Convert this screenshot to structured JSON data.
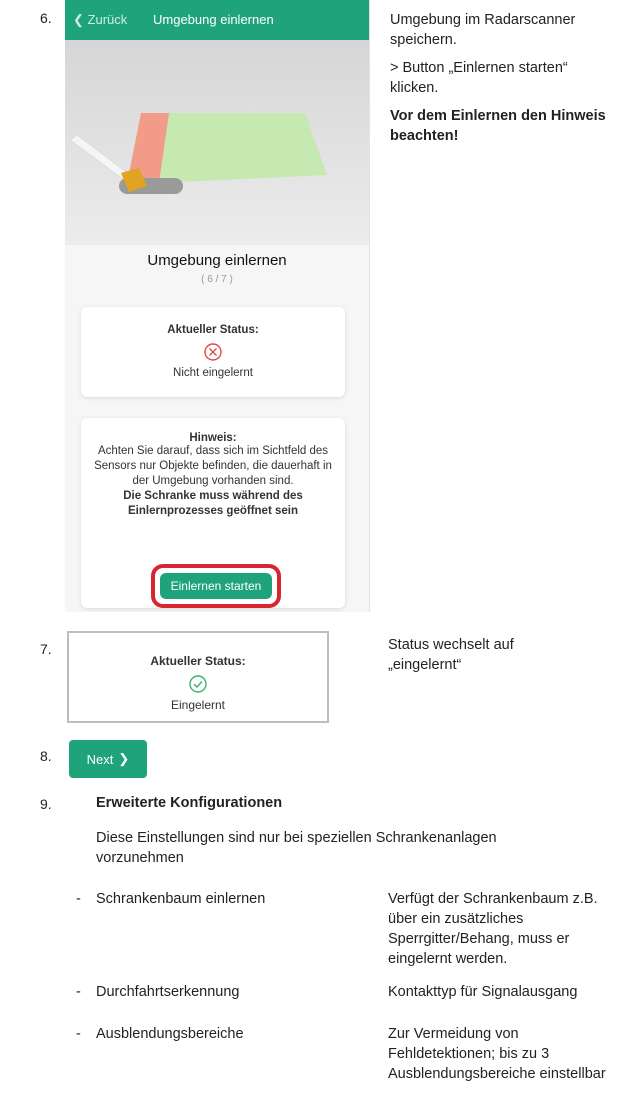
{
  "steps": {
    "s6": {
      "number": "6.",
      "phone": {
        "back_label": "Zurück",
        "title": "Umgebung einlernen",
        "panel_title": "Umgebung einlernen",
        "step_indicator": "( 6 / 7 )",
        "status_card": {
          "heading": "Aktueller Status:",
          "icon": "x-circle-icon",
          "text": "Nicht eingelernt",
          "color": "#e24a4a"
        },
        "hint_card": {
          "heading": "Hinweis:",
          "body": "Achten Sie darauf, dass sich im Sichtfeld des Sensors nur Objekte befinden, die dauerhaft in der Umgebung vorhanden sind.",
          "bold": "Die Schranke muss während des Einlernprozesses geöffnet sein"
        },
        "start_button": "Einlernen starten",
        "accent": "#1fa37a",
        "highlight": "#d9252f"
      },
      "side_line1": "Umgebung im Radarscanner speichern.",
      "side_line2": "> Button „Einlernen starten“ klicken.",
      "side_bold": "Vor dem Einlernen den Hinweis beachten!"
    },
    "s7": {
      "number": "7.",
      "status_heading": "Aktueller Status:",
      "status_icon": "check-circle-icon",
      "status_text": "Eingelernt",
      "status_color": "#3bb36a",
      "side": "Status wechselt auf „eingelernt“"
    },
    "s8": {
      "number": "8.",
      "button": "Next"
    },
    "s9": {
      "number": "9.",
      "title": "Erweiterte Konfigurationen",
      "desc": "Diese Einstellungen sind nur bei speziellen Schrankenanlagen vorzunehmen",
      "items": [
        {
          "dash": "-",
          "label": "Schrankenbaum einlernen",
          "desc": "Verfügt der Schrankenbaum z.B. über ein zusätzliches Sperrgitter/Behang, muss er eingelernt werden."
        },
        {
          "dash": "-",
          "label": "Durchfahrtserkennung",
          "desc": "Kontakttyp für Signalausgang"
        },
        {
          "dash": "-",
          "label": "Ausblendungsbereiche",
          "desc": "Zur Vermeidung von Fehldetektionen; bis zu 3 Ausblendungsbereiche einstellbar"
        }
      ]
    }
  }
}
